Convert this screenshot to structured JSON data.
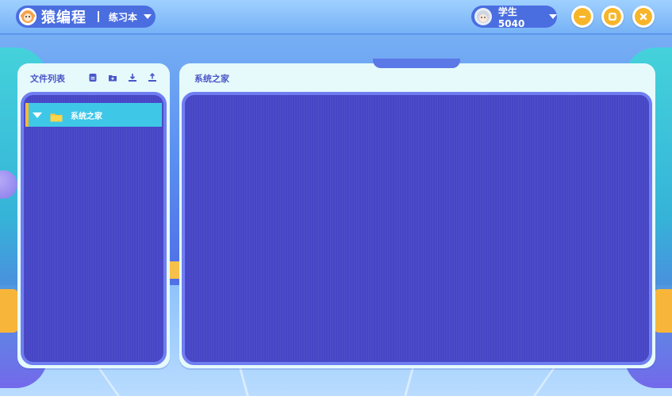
{
  "app": {
    "brand_name": "猿编程",
    "mode_label": "练习本"
  },
  "user": {
    "name": "学生5040"
  },
  "window_controls": {
    "icons": [
      "minimize-icon",
      "maximize-icon",
      "close-icon"
    ],
    "accent": "#f7b52a"
  },
  "file_panel": {
    "title": "文件列表",
    "toolbar_icons": [
      "new-file-icon",
      "new-folder-icon",
      "download-icon",
      "upload-icon"
    ],
    "tree": [
      {
        "label": "系统之家",
        "icon": "folder-icon",
        "expanded": true,
        "selected": true
      }
    ]
  },
  "editor_panel": {
    "title": "系统之家"
  },
  "colors": {
    "panel_bg": "#e6fafc",
    "workspace_bg": "#4746c6",
    "selected_row": "#3fc7e8",
    "title_text": "#4a56c8"
  }
}
